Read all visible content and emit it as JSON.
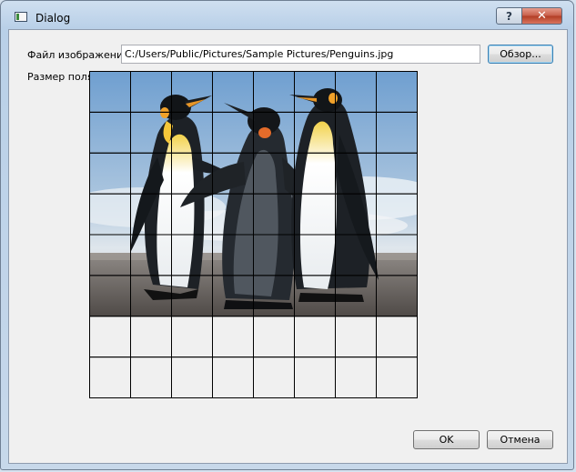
{
  "window": {
    "title": "Dialog",
    "help_glyph": "?",
    "close_glyph": "✕"
  },
  "form": {
    "file_label": "Файл изображения",
    "file_path": "C:/Users/Public/Pictures/Sample Pictures/Penguins.jpg",
    "browse_label": "Обзор...",
    "field_size_label": "Размер поля"
  },
  "field": {
    "columns": 8,
    "rows": 8,
    "image_rows": 6,
    "image_description": "penguins"
  },
  "buttons": {
    "ok_label": "OK",
    "cancel_label": "Отмена"
  },
  "colors": {
    "accent": "#3c7fb1",
    "close_red": "#c75d48"
  }
}
